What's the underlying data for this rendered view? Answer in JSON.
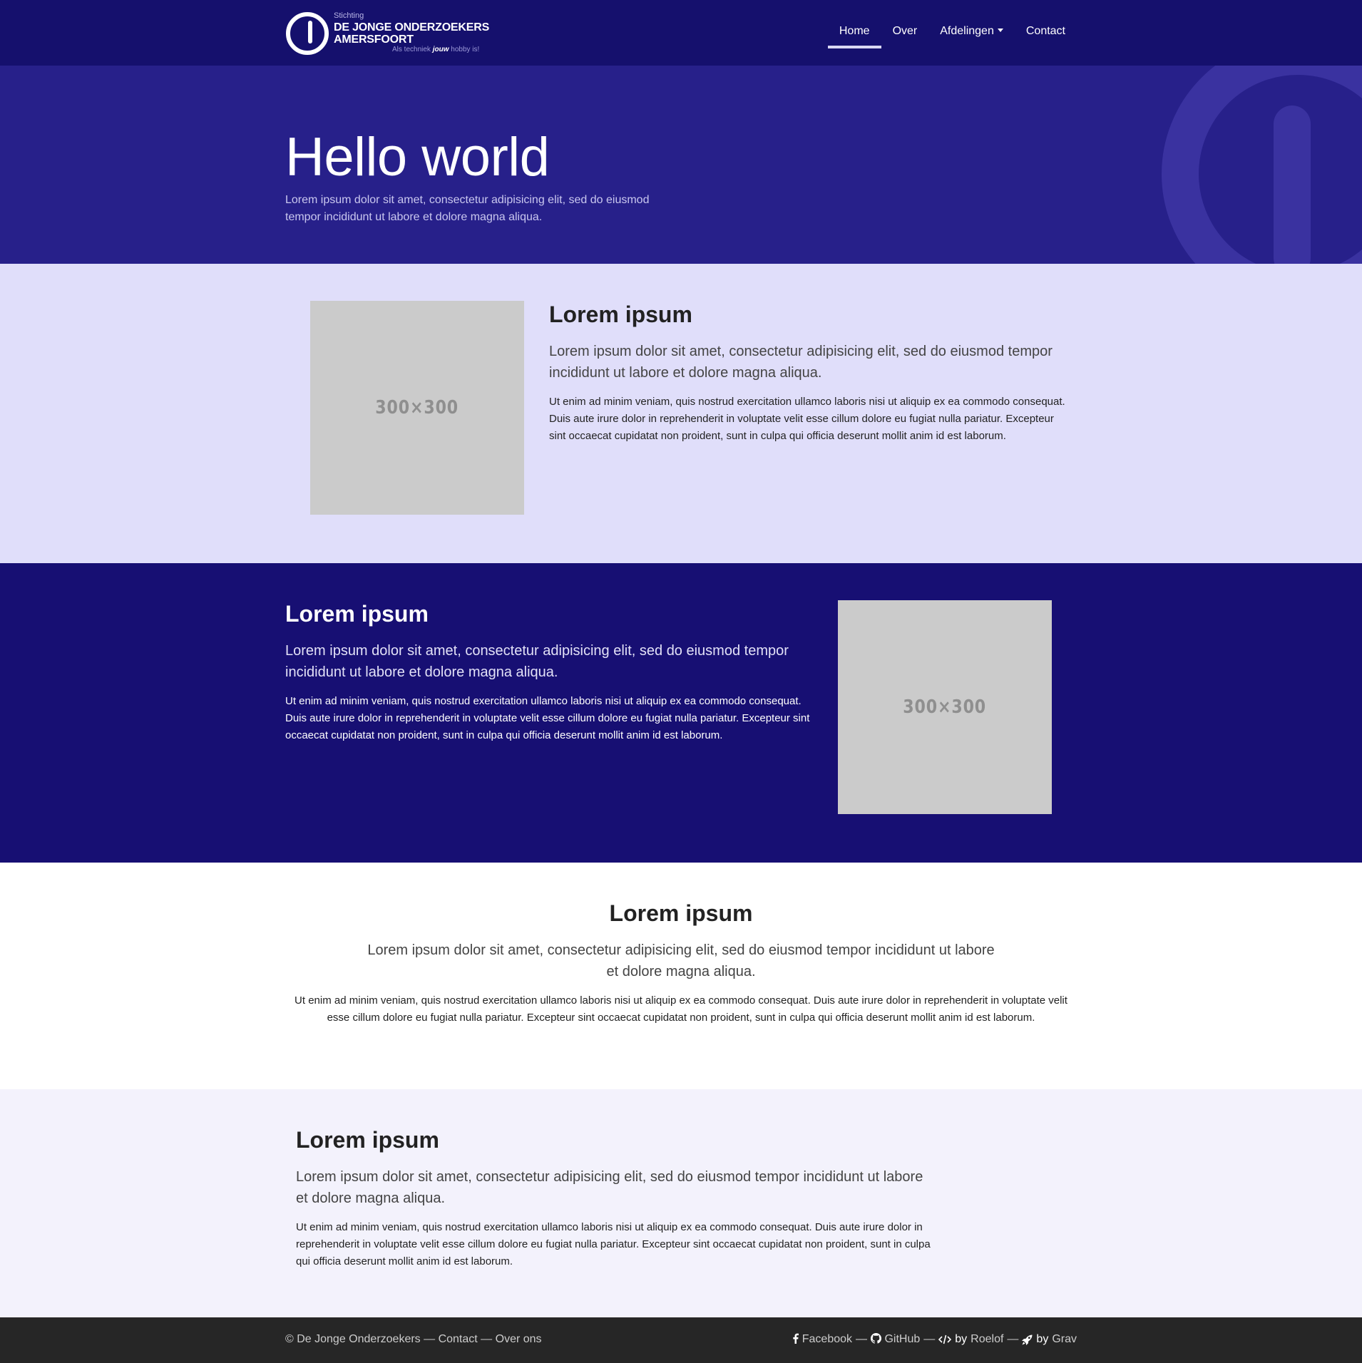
{
  "navbar": {
    "logo": {
      "small": "Stichting",
      "line1": "DE JONGE ONDERZOEKERS",
      "line2": "AMERSFOORT",
      "tag_pre": "Als techniek ",
      "tag_bold": "jouw",
      "tag_post": " hobby is!"
    },
    "items": [
      {
        "label": "Home",
        "active": true
      },
      {
        "label": "Over"
      },
      {
        "label": "Afdelingen",
        "dropdown": true
      },
      {
        "label": "Contact"
      }
    ]
  },
  "hero": {
    "title": "Hello world",
    "lead": "Lorem ipsum dolor sit amet, consectetur adipisicing elit, sed do eiusmod tempor incididunt ut labore et dolore magna aliqua."
  },
  "sections": [
    {
      "heading": "Lorem ipsum",
      "lead": "Lorem ipsum dolor sit amet, consectetur adipisicing elit, sed do eiusmod tempor incididunt ut labore et dolore magna aliqua.",
      "body": "Ut enim ad minim veniam, quis nostrud exercitation ullamco laboris nisi ut aliquip ex ea commodo consequat. Duis aute irure dolor in reprehenderit in voluptate velit esse cillum dolore eu fugiat nulla pariatur. Excepteur sint occaecat cupidatat non proident, sunt in culpa qui officia deserunt mollit anim id est laborum.",
      "image_label": "300×300"
    },
    {
      "heading": "Lorem ipsum",
      "lead": "Lorem ipsum dolor sit amet, consectetur adipisicing elit, sed do eiusmod tempor incididunt ut labore et dolore magna aliqua.",
      "body": "Ut enim ad minim veniam, quis nostrud exercitation ullamco laboris nisi ut aliquip ex ea commodo consequat. Duis aute irure dolor in reprehenderit in voluptate velit esse cillum dolore eu fugiat nulla pariatur. Excepteur sint occaecat cupidatat non proident, sunt in culpa qui officia deserunt mollit anim id est laborum.",
      "image_label": "300×300"
    },
    {
      "heading": "Lorem ipsum",
      "lead": "Lorem ipsum dolor sit amet, consectetur adipisicing elit, sed do eiusmod tempor incididunt ut labore et dolore magna aliqua.",
      "body": "Ut enim ad minim veniam, quis nostrud exercitation ullamco laboris nisi ut aliquip ex ea commodo consequat. Duis aute irure dolor in reprehenderit in voluptate velit esse cillum dolore eu fugiat nulla pariatur. Excepteur sint occaecat cupidatat non proident, sunt in culpa qui officia deserunt mollit anim id est laborum."
    },
    {
      "heading": "Lorem ipsum",
      "lead": "Lorem ipsum dolor sit amet, consectetur adipisicing elit, sed do eiusmod tempor incididunt ut labore et dolore magna aliqua.",
      "body": "Ut enim ad minim veniam, quis nostrud exercitation ullamco laboris nisi ut aliquip ex ea commodo consequat. Duis aute irure dolor in reprehenderit in voluptate velit esse cillum dolore eu fugiat nulla pariatur. Excepteur sint occaecat cupidatat non proident, sunt in culpa qui officia deserunt mollit anim id est laborum."
    }
  ],
  "footer": {
    "copyright": "© De Jonge Onderzoekers",
    "sep": "—",
    "contact": "Contact",
    "about": "Over ons",
    "facebook": "Facebook",
    "github": "GitHub",
    "by": "by",
    "roelof": "Roelof",
    "grav": "Grav",
    "icons": [
      "facebook-icon",
      "github-icon",
      "code-icon",
      "rocket-icon"
    ]
  },
  "colors": {
    "navbar_bg": "#15106d",
    "hero_bg": "#27208a",
    "section_light_bg": "#e0defa",
    "section_dark_bg": "#170f73",
    "section_pale_bg": "#f3f2fc",
    "footer_bg": "#262626",
    "placeholder_bg": "#cbcbcb"
  }
}
